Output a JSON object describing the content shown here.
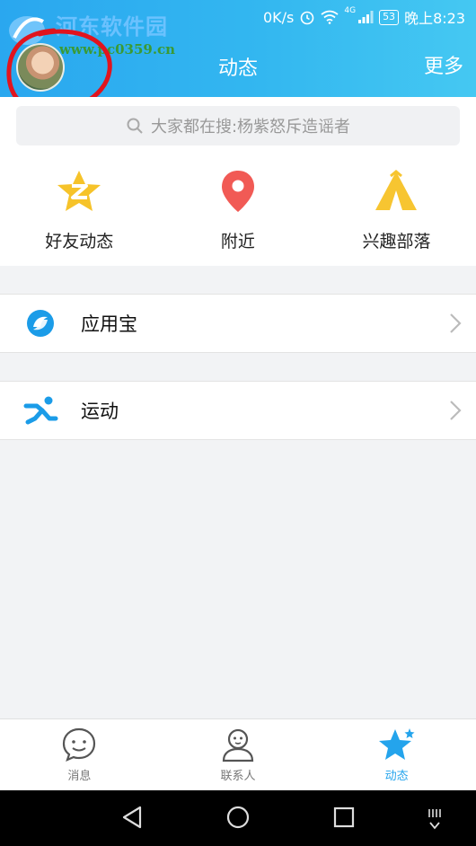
{
  "status_bar": {
    "speed": "0K/s",
    "network": "4G",
    "battery": "53",
    "time": "晚上8:23"
  },
  "watermark": {
    "title": "河东软件园",
    "url": "www.pc0359.cn"
  },
  "header": {
    "title": "动态",
    "more_label": "更多"
  },
  "search": {
    "placeholder": "大家都在搜:杨紫怒斥造谣者"
  },
  "features": [
    {
      "label": "好友动态",
      "icon": "qzone-star-icon",
      "color": "#f6c32a"
    },
    {
      "label": "附近",
      "icon": "location-pin-icon",
      "color": "#f15a55"
    },
    {
      "label": "兴趣部落",
      "icon": "tribe-tent-icon",
      "color": "#f7c531"
    }
  ],
  "list": [
    {
      "label": "应用宝",
      "icon": "app-store-icon",
      "color": "#1b9ce8"
    },
    {
      "label": "运动",
      "icon": "running-icon",
      "color": "#1b9ce8"
    }
  ],
  "tabs": [
    {
      "label": "消息",
      "icon": "message-icon",
      "active": false
    },
    {
      "label": "联系人",
      "icon": "contacts-icon",
      "active": false
    },
    {
      "label": "动态",
      "icon": "star-icon",
      "active": true
    }
  ],
  "colors": {
    "accent": "#24a4ec",
    "header_start": "#2aa7ef",
    "header_end": "#45c8f2",
    "annotation": "#e0141e"
  }
}
